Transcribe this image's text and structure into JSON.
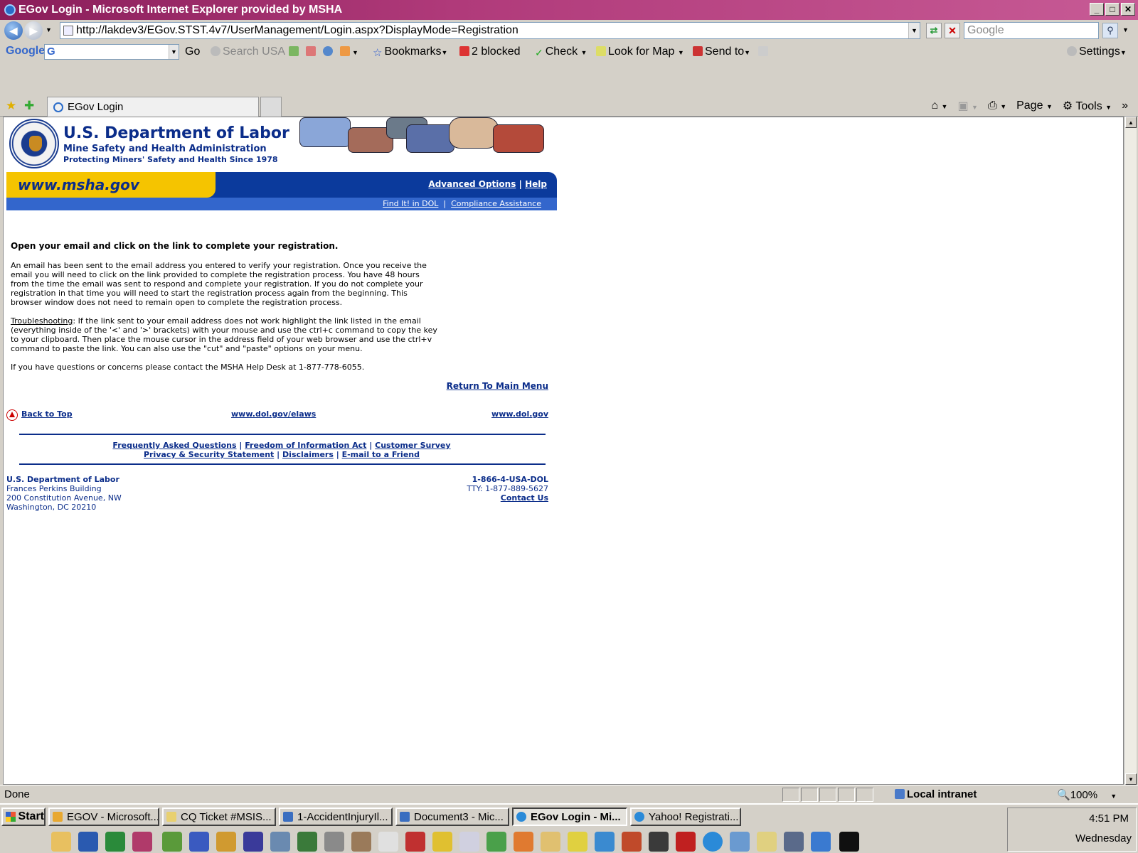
{
  "window": {
    "title": "EGov Login - Microsoft Internet Explorer provided by MSHA"
  },
  "address": {
    "url": "http://lakdev3/EGov.STST.4v7/UserManagement/Login.aspx?DisplayMode=Registration",
    "search_placeholder": "Google"
  },
  "google_toolbar": {
    "logo": "Google",
    "go": "Go",
    "search_usa": "Search USA",
    "bookmarks": "Bookmarks",
    "blocked": "2 blocked",
    "check": "Check",
    "look_for_map": "Look for Map",
    "send_to": "Send to",
    "settings": "Settings"
  },
  "tab": {
    "label": "EGov Login"
  },
  "command_bar": {
    "page": "Page",
    "tools": "Tools"
  },
  "header": {
    "org": "U.S. Department of Labor",
    "agency": "Mine Safety and Health Administration",
    "tagline": "Protecting Miners' Safety and Health Since 1978",
    "site": "www.msha.gov",
    "advanced_options": "Advanced Options",
    "help": "Help",
    "find_it": "Find It! in DOL",
    "compliance": "Compliance Assistance",
    "sep": "|"
  },
  "main": {
    "heading": "Open your email and click on the link to complete your registration.",
    "para1": "An email has been sent to the email address you entered to verify your registration.  Once you receive the email you will need to click on the link provided to complete the registration process.  You have 48 hours from the time the email was sent to respond and complete your registration.  If you do not complete your registration in that time you will need to start the registration process again from the beginning.  This browser window does not need to remain open to complete the registration process.",
    "trouble_label": "Troubleshooting",
    "trouble_text": ":  If the link sent to your email address does not work highlight the link listed in the email (everything inside of the '<' and '>' brackets) with your mouse and use the ctrl+c command to copy the key to your clipboard. Then place the mouse cursor in the address field of your web browser and use the ctrl+v command to paste the link.  You can also use the \"cut\" and \"paste\" options on your menu.",
    "para3": "If you have questions or concerns please contact the MSHA Help Desk at 1-877-778-6055.",
    "return": "Return To Main Menu"
  },
  "footer": {
    "back_to_top": "Back to Top",
    "elaws": "www.dol.gov/elaws",
    "dol": "www.dol.gov",
    "faq": "Frequently Asked Questions",
    "foia": "Freedom of Information Act",
    "survey": "Customer Survey",
    "privacy": "Privacy & Security Statement",
    "disclaimers": "Disclaimers",
    "email_friend": "E-mail to a Friend",
    "addr_org": "U.S. Department of Labor",
    "addr_bldg": "Frances Perkins Building",
    "addr_street": "200 Constitution Avenue, NW",
    "addr_city": "Washington, DC 20210",
    "phone": "1-866-4-USA-DOL",
    "tty": "TTY: 1-877-889-5627",
    "contact": "Contact Us"
  },
  "status": {
    "text": "Done",
    "zone": "Local intranet",
    "zoom": "100%"
  },
  "taskbar": {
    "start": "Start",
    "items": [
      {
        "label": "EGOV - Microsoft..."
      },
      {
        "label": "CQ Ticket #MSIS..."
      },
      {
        "label": "1-AccidentInjuryIl..."
      },
      {
        "label": "Document3 - Mic..."
      },
      {
        "label": "EGov Login - Mi..."
      },
      {
        "label": "Yahoo! Registrati..."
      }
    ],
    "time": "4:51 PM",
    "day": "Wednesday"
  }
}
